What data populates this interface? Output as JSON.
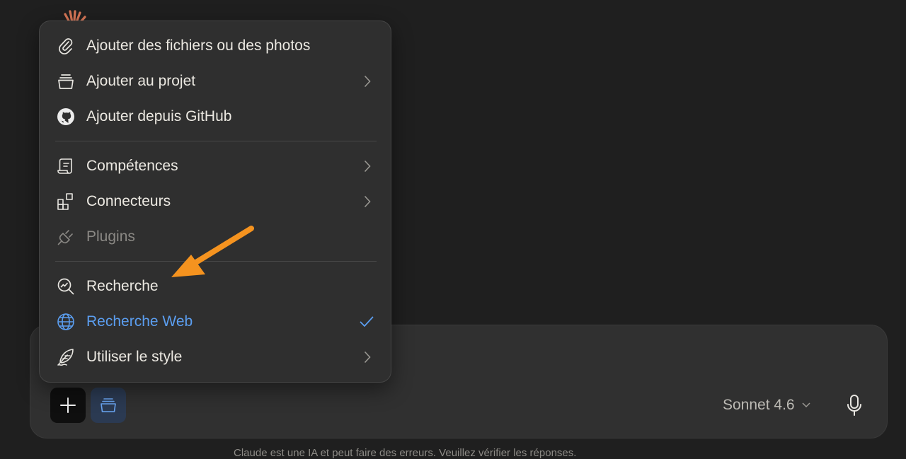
{
  "menu": {
    "items": [
      {
        "label": "Ajouter des fichiers ou des photos",
        "icon": "paperclip-icon"
      },
      {
        "label": "Ajouter au projet",
        "icon": "project-box-icon"
      },
      {
        "label": "Ajouter depuis GitHub",
        "icon": "github-icon"
      },
      {
        "label": "Compétences",
        "icon": "scroll-icon"
      },
      {
        "label": "Connecteurs",
        "icon": "blocks-icon"
      },
      {
        "label": "Plugins",
        "icon": "plug-icon"
      },
      {
        "label": "Recherche",
        "icon": "research-icon"
      },
      {
        "label": "Recherche Web",
        "icon": "globe-icon",
        "checked": true
      },
      {
        "label": "Utiliser le style",
        "icon": "quill-icon"
      }
    ]
  },
  "composer": {
    "model_label": "Sonnet 4.6"
  },
  "footer": {
    "text": "Claude est une IA et peut faire des erreurs. Veuillez vérifier les réponses."
  },
  "colors": {
    "accent": "#5b9ef0",
    "arrow": "#f5931f",
    "logo": "#d97757"
  }
}
